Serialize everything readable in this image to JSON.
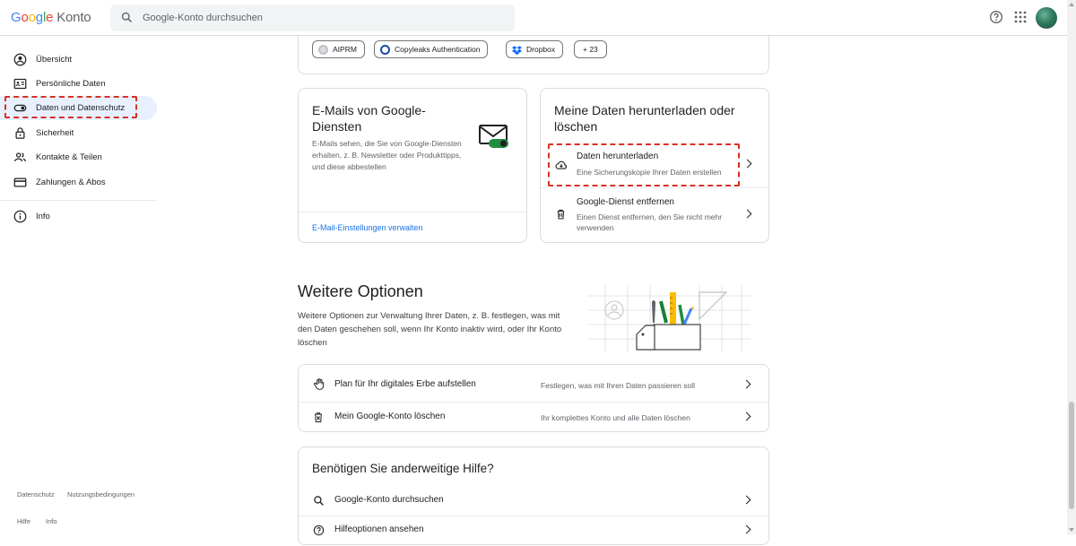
{
  "header": {
    "logo_google": "Google",
    "logo_product": "Konto",
    "search_placeholder": "Google-Konto durchsuchen"
  },
  "sidebar": {
    "items": [
      {
        "label": "Übersicht",
        "icon": "account-circle-icon"
      },
      {
        "label": "Persönliche Daten",
        "icon": "id-card-icon"
      },
      {
        "label": "Daten und Datenschutz",
        "icon": "toggle-icon",
        "active": true
      },
      {
        "label": "Sicherheit",
        "icon": "lock-icon"
      },
      {
        "label": "Kontakte & Teilen",
        "icon": "people-icon"
      },
      {
        "label": "Zahlungen & Abos",
        "icon": "credit-card-icon"
      },
      {
        "label": "Info",
        "icon": "info-icon"
      }
    ],
    "footer": {
      "privacy": "Datenschutz",
      "terms": "Nutzungsbedingungen",
      "help": "Hilfe",
      "info": "Info"
    }
  },
  "third_party_card": {
    "chips": [
      {
        "label": "AIPRM",
        "icon": "aiprm-icon"
      },
      {
        "label": "Copyleaks Authentication",
        "icon": "copyleaks-icon"
      },
      {
        "label": "Dropbox",
        "icon": "dropbox-icon"
      },
      {
        "label": "+ 23"
      }
    ]
  },
  "email_card": {
    "title": "E-Mails von Google-Diensten",
    "description": "E-Mails sehen, die Sie von Google-Diensten erhalten, z. B. Newsletter oder Produkttipps, und diese abbestellen",
    "link": "E-Mail-Einstellungen verwalten"
  },
  "download_card": {
    "title": "Meine Daten herunterladen oder löschen",
    "rows": [
      {
        "title": "Daten herunterladen",
        "subtitle": "Eine Sicherungskopie Ihrer Daten erstellen",
        "icon": "cloud-download-icon"
      },
      {
        "title": "Google-Dienst entfernen",
        "subtitle": "Einen Dienst entfernen, den Sie nicht mehr verwenden",
        "icon": "trash-icon"
      }
    ]
  },
  "more_options": {
    "heading": "Weitere Optionen",
    "description": "Weitere Optionen zur Verwaltung Ihrer Daten, z. B. festlegen, was mit den Daten geschehen soll, wenn Ihr Konto inaktiv wird, oder Ihr Konto löschen",
    "rows": [
      {
        "title": "Plan für Ihr digitales Erbe aufstellen",
        "subtitle": "Festlegen, was mit Ihren Daten passieren soll",
        "icon": "hand-icon"
      },
      {
        "title": "Mein Google-Konto löschen",
        "subtitle": "Ihr komplettes Konto und alle Daten löschen",
        "icon": "delete-account-icon"
      }
    ]
  },
  "help_card": {
    "title": "Benötigen Sie anderweitige Hilfe?",
    "rows": [
      {
        "title": "Google-Konto durchsuchen",
        "icon": "search-icon"
      },
      {
        "title": "Hilfeoptionen ansehen",
        "icon": "help-circle-icon"
      }
    ]
  },
  "colors": {
    "accent": "#1a73e8",
    "active_nav_bg": "#e8f0fe",
    "highlight_dash": "#d93025"
  }
}
